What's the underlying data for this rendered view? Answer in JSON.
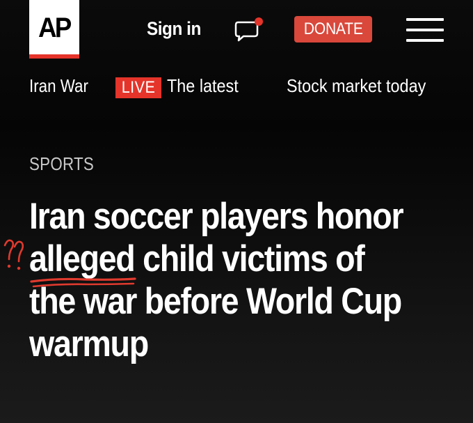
{
  "header": {
    "logo_text": "AP",
    "sign_in_label": "Sign in",
    "donate_label": "DONATE",
    "accent_color": "#e5342a",
    "chat_icon": "chat-bubble-icon",
    "menu_icon": "hamburger-menu-icon"
  },
  "nav": {
    "items": [
      {
        "label": "Iran War"
      },
      {
        "badge": "LIVE",
        "label": "The latest"
      },
      {
        "label": "Stock market today"
      }
    ]
  },
  "article": {
    "section": "SPORTS",
    "headline_lines": [
      "Iran soccer players honor",
      "alleged",
      " child victims of",
      "the war before World Cup",
      "warmup"
    ]
  },
  "annotations": {
    "color": "#e03a2e",
    "marks": [
      "question-marks",
      "underline-alleged"
    ]
  }
}
